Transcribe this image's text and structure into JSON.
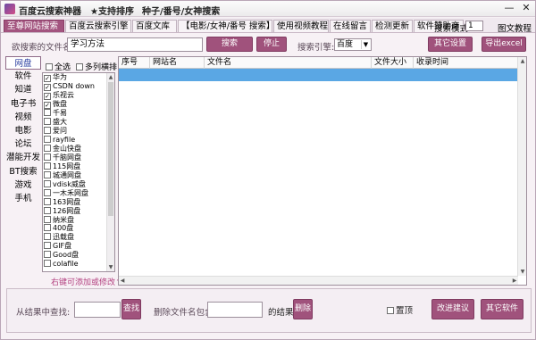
{
  "window": {
    "title_parts": [
      "百度云搜索神器",
      "★支持排序",
      "种子/番号/女神搜索"
    ],
    "controls": {
      "minimize": "—",
      "close": "✕"
    }
  },
  "tabs": [
    {
      "label": "至尊网站搜索",
      "active": true
    },
    {
      "label": "百度云搜索引擎",
      "active": false
    },
    {
      "label": "百度文库",
      "active": false
    },
    {
      "label": "【电影/女神/番号 搜索】",
      "active": false
    },
    {
      "label": "使用视频教程",
      "active": false
    },
    {
      "label": "在线留言",
      "active": false
    },
    {
      "label": "检测更新",
      "active": false
    },
    {
      "label": "软件赞助商",
      "active": false
    }
  ],
  "search_mode": {
    "label": "搜索模式",
    "value": "1"
  },
  "tutorial_link": "图文教程",
  "search": {
    "label": "欲搜索的文件名:",
    "value": "学习方法",
    "search_button": "搜索",
    "stop_button": "停止",
    "engine_label": "搜索引擎:",
    "engine_value": "百度",
    "settings_button": "其它设置",
    "export_button": "导出excel"
  },
  "categories": [
    "网盘",
    "软件",
    "知道",
    "电子书",
    "视频",
    "电影",
    "论坛",
    "潜能开发",
    "BT搜索",
    "游戏",
    "手机"
  ],
  "site_panel": {
    "select_all": "全选",
    "multi_sort": "多列横排",
    "sites": [
      {
        "name": "华为",
        "checked": true
      },
      {
        "name": "CSDN down",
        "checked": true
      },
      {
        "name": "乐视云",
        "checked": true
      },
      {
        "name": "微盘",
        "checked": true
      },
      {
        "name": "千易",
        "checked": false
      },
      {
        "name": "盛大",
        "checked": false
      },
      {
        "name": "爱问",
        "checked": false
      },
      {
        "name": "rayfile",
        "checked": false
      },
      {
        "name": "金山快盘",
        "checked": false
      },
      {
        "name": "千脑网盘",
        "checked": false
      },
      {
        "name": "115网盘",
        "checked": false
      },
      {
        "name": "城通网盘",
        "checked": false
      },
      {
        "name": "vdisk威盘",
        "checked": false
      },
      {
        "name": "一木禾网盘",
        "checked": false
      },
      {
        "name": "163网盘",
        "checked": false
      },
      {
        "name": "126网盘",
        "checked": false
      },
      {
        "name": "纳米盘",
        "checked": false
      },
      {
        "name": "400盘",
        "checked": false
      },
      {
        "name": "迅载盘",
        "checked": false
      },
      {
        "name": "GIF盘",
        "checked": false
      },
      {
        "name": "Good盘",
        "checked": false
      },
      {
        "name": "colafile",
        "checked": false
      }
    ],
    "hint": "右键可添加或修改↑"
  },
  "table": {
    "columns": [
      "序号",
      "网站名",
      "文件名",
      "文件大小",
      "收录时间"
    ]
  },
  "bottom": {
    "find_label": "从结果中查找:",
    "find_value": "",
    "find_button": "查找",
    "delete_label": "删除文件名包含:",
    "delete_value": "",
    "result_label": "的结果",
    "delete_button": "删除",
    "pin_label": "置顶",
    "feedback_button": "改进建议",
    "other_software_button": "其它软件"
  },
  "colors": {
    "accent": "#a0527c",
    "selection": "#5aa7e4",
    "hint": "#b23e7e"
  }
}
